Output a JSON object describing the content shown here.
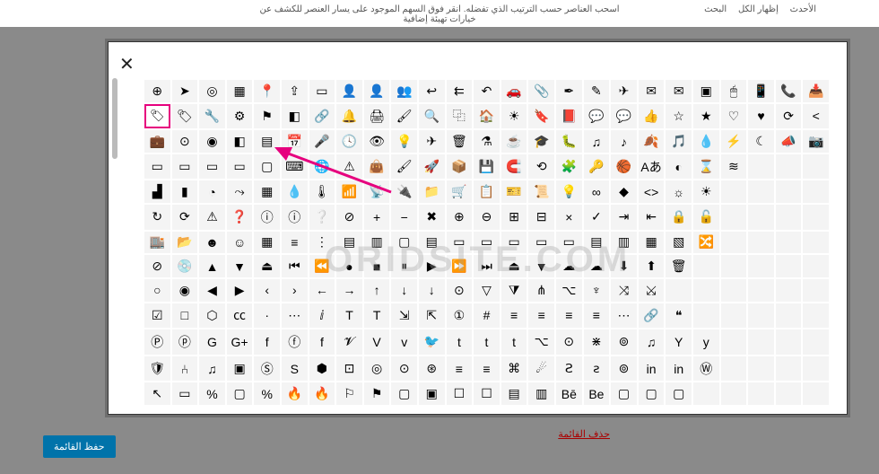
{
  "top_instruction": "اسحب العناصر حسب الترتيب الذي تفضله. انقر فوق السهم الموجود على يسار العنصر للكشف عن خيارات تهيئة إضافية",
  "tabs": {
    "recent": "الأحدث",
    "all": "إظهار الكل",
    "search": "البحث"
  },
  "delete_label": "حذف القائمة",
  "save_label": "حفظ القائمة",
  "watermark": "ORIDSITE.COM",
  "selected_index": 25,
  "icons": [
    "crosshair-icon",
    "location-arrow-icon",
    "compass-icon",
    "map-icon",
    "map-marker-icon",
    "export-icon",
    "contact-card-icon",
    "user-add-icon",
    "user-icon",
    "users-icon",
    "reply-icon",
    "reply-all-icon",
    "undo-icon",
    "car-icon",
    "paperclip-icon",
    "feather-icon",
    "pencil-icon",
    "paper-plane-icon",
    "mail-icon",
    "mail-open-icon",
    "envelope-icon",
    "mouse-icon",
    "mobile-icon",
    "phone-icon",
    "inbox-icon",
    "tag-icon",
    "tags-icon",
    "wrench-icon",
    "gear-icon",
    "flag-icon",
    "color-icon",
    "link-icon",
    "bell-icon",
    "printer-icon",
    "brush-icon",
    "search-icon",
    "copy-icon",
    "home-icon",
    "sun-icon",
    "bookmark-icon",
    "book-icon",
    "chat-icon",
    "chat-alt-icon",
    "thumbs-up-icon",
    "star-outline-icon",
    "star-icon",
    "heart-outline-icon",
    "heart-icon",
    "refresh-icon",
    "share-icon",
    "briefcase-icon",
    "disc-icon",
    "target-icon",
    "approve-icon",
    "calculator-icon",
    "calendar-icon",
    "mic-icon",
    "clock-icon",
    "eye-icon",
    "bulb-icon",
    "plane-icon",
    "trash-icon",
    "beaker-icon",
    "coffee-icon",
    "graduation-icon",
    "bug-icon",
    "music-icon",
    "note-icon",
    "leaf-icon",
    "notes-icon",
    "drop-icon",
    "bolt-icon",
    "moon-icon",
    "megaphone-icon",
    "camera-icon",
    "battery-empty-icon",
    "battery-low-icon",
    "battery-mid-icon",
    "battery-full-icon",
    "window-icon",
    "keyboard-icon",
    "globe-icon",
    "warning-icon",
    "bag-icon",
    "paint-icon",
    "rocket-icon",
    "archive-icon",
    "save-icon",
    "magnet-icon",
    "loop-icon",
    "puzzle-icon",
    "key-icon",
    "basketball-icon",
    "language-icon",
    "dashboard-icon",
    "hourglass-icon",
    "water-icon",
    "blank1-icon",
    "blank2-icon",
    "blank3-icon",
    "area-chart-icon",
    "bar-chart-icon",
    "pie-chart-icon",
    "trend-icon",
    "grid-icon",
    "droplets-icon",
    "thermometer-icon",
    "wifi-icon",
    "rss-icon",
    "plug-icon",
    "folder-icon",
    "cart-icon",
    "clipboard-icon",
    "ticket-icon",
    "certificate-icon",
    "lightbulb-icon",
    "infinity-icon",
    "diamond-icon",
    "code-icon",
    "brightness-icon",
    "sun-small-icon",
    "blank4-icon",
    "blank5-icon",
    "blank6-icon",
    "blank7-icon",
    "rotate-icon",
    "sync-icon",
    "alert-icon",
    "question-icon",
    "info-solid-icon",
    "info-icon",
    "help-icon",
    "block-icon",
    "plus-icon",
    "minus-icon",
    "close-icon",
    "add-circle-icon",
    "remove-circle-icon",
    "plus-square-icon",
    "minus-square-icon",
    "times-icon",
    "check-icon",
    "login-icon",
    "logout-icon",
    "lock-icon",
    "lock-open-icon",
    "blank8-icon",
    "blank9-icon",
    "blank10-icon",
    "blank11-icon",
    "store-icon",
    "folder-open-icon",
    "face-icon",
    "smile-icon",
    "grid2-icon",
    "list-icon",
    "bullets-icon",
    "cards-icon",
    "layout-icon",
    "window2-icon",
    "form-icon",
    "note2-icon",
    "tile1-icon",
    "tile2-icon",
    "tile3-icon",
    "tile4-icon",
    "layout2-icon",
    "layout3-icon",
    "layout4-icon",
    "layout5-icon",
    "shuffle-icon",
    "blank12-icon",
    "blank13-icon",
    "blank14-icon",
    "blank15-icon",
    "crossed-icon",
    "vinyl-icon",
    "caret-up-icon",
    "caret-down-icon",
    "eject-icon",
    "prev-icon",
    "rewind-icon",
    "record-icon",
    "stop-icon",
    "pause-icon",
    "play-icon",
    "forward-icon",
    "next-icon",
    "eject2-icon",
    "down-solid-icon",
    "cloud-icon",
    "cloud-down-icon",
    "download-icon",
    "upload-icon",
    "trash2-icon",
    "blank16-icon",
    "blank17-icon",
    "blank18-icon",
    "blank19-icon",
    "blank20-icon",
    "radio-off-icon",
    "radio-on-icon",
    "caret-left-icon",
    "caret-right-icon",
    "angle-left-icon",
    "angle-right-icon",
    "arrow-left-icon",
    "arrow-right-icon",
    "arrow-up-icon",
    "arrow-down-icon",
    "long-down-icon",
    "circle-down-icon",
    "triangle-down-icon",
    "filter-icon",
    "flow-icon",
    "sitemap-icon",
    "tree-icon",
    "split-icon",
    "merge-icon",
    "blank21-icon",
    "blank22-icon",
    "blank23-icon",
    "blank24-icon",
    "blank25-icon",
    "blank26-icon",
    "checkbox-icon",
    "square-icon",
    "hexagon-icon",
    "cc-icon",
    "dot-icon",
    "dots-icon",
    "italic-icon",
    "text-icon",
    "text2-icon",
    "size-icon",
    "size2-icon",
    "number-icon",
    "hash-icon",
    "align-left-icon",
    "align-right-icon",
    "align-center-icon",
    "justify-icon",
    "more-icon",
    "link2-icon",
    "quote-icon",
    "blank27-icon",
    "blank28-icon",
    "blank29-icon",
    "blank30-icon",
    "blank31-icon",
    "pinterest-icon",
    "pinterest-alt-icon",
    "google-icon",
    "googleplus-icon",
    "facebook-icon",
    "facebook-circle-icon",
    "facebook-square-icon",
    "vine-icon",
    "vimeo-icon",
    "vimeo-alt-icon",
    "twitter-icon",
    "twitter-alt-icon",
    "tumblr-icon",
    "tumblr-alt-icon",
    "github-icon",
    "github-alt-icon",
    "slack-icon",
    "spotify-circle-icon",
    "spotify-icon",
    "yelp-icon",
    "yelp-alt-icon",
    "blank32-icon",
    "blank33-icon",
    "blank34-icon",
    "blank35-icon",
    "shield2-icon",
    "split2-icon",
    "spotify2-icon",
    "inbox2-icon",
    "skype-icon",
    "skype-alt-icon",
    "dropbox-icon",
    "instagram-icon",
    "instagram-alt-icon",
    "pin-circle-icon",
    "renren-icon",
    "stack-icon",
    "stack-alt-icon",
    "lastfm-icon",
    "comment-icon",
    "stumble-icon",
    "stumble-alt-icon",
    "dribbble-icon",
    "linkedin-circle-icon",
    "linkedin-icon",
    "wordpress-icon",
    "blank36-icon",
    "blank37-icon",
    "blank38-icon",
    "blank39-icon",
    "cursor-icon",
    "selection-icon",
    "percent-icon",
    "album-icon",
    "percent2-icon",
    "fire-icon",
    "fire-alt-icon",
    "flag2-icon",
    "flag3-icon",
    "app-icon",
    "app2-icon",
    "box-icon",
    "box2-icon",
    "panel-icon",
    "panel2-icon",
    "behance-icon",
    "behance-alt-icon",
    "square3-icon",
    "square4-icon",
    "square5-icon",
    "blank40-icon",
    "blank41-icon",
    "blank42-icon",
    "blank43-icon",
    "blank44-icon"
  ],
  "glyphs": [
    "⊕",
    "➤",
    "◎",
    "▦",
    "📍",
    "⇪",
    "▭",
    "👤",
    "👤",
    "👥",
    "↩",
    "⇇",
    "↶",
    "🚗",
    "📎",
    "✒",
    "✎",
    "✈",
    "✉",
    "✉",
    "▣",
    "🖱",
    "📱",
    "📞",
    "📥",
    "🏷",
    "🏷",
    "🔧",
    "⚙",
    "⚑",
    "◧",
    "🔗",
    "🔔",
    "🖨",
    "🖌",
    "🔍",
    "⿻",
    "🏠",
    "☀",
    "🔖",
    "📕",
    "💬",
    "💬",
    "👍",
    "☆",
    "★",
    "♡",
    "♥",
    "⟳",
    "<",
    "💼",
    "⊙",
    "◉",
    "◧",
    "▤",
    "📅",
    "🎤",
    "🕓",
    "👁",
    "💡",
    "✈",
    "🗑",
    "⚗",
    "☕",
    "🎓",
    "🐛",
    "♫",
    "♪",
    "🍂",
    "🎵",
    "💧",
    "⚡",
    "☾",
    "📣",
    "📷",
    "▭",
    "▭",
    "▭",
    "▭",
    "▢",
    "⌨",
    "🌐",
    "⚠",
    "👜",
    "🖌",
    "🚀",
    "📦",
    "💾",
    "🧲",
    "⟲",
    "🧩",
    "🔑",
    "🏀",
    "Aあ",
    "◐",
    "⌛",
    "≋",
    "",
    "",
    "",
    "▟",
    "▮",
    "◔",
    "⤳",
    "▦",
    "💧",
    "🌡",
    "📶",
    "📡",
    "🔌",
    "📁",
    "🛒",
    "📋",
    "🎫",
    "📜",
    "💡",
    "∞",
    "◆",
    "<>",
    "☼",
    "☀",
    "",
    "",
    "",
    "",
    "↻",
    "⟳",
    "⚠",
    "❓",
    "ⓘ",
    "ⓘ",
    "❔",
    "⊘",
    "+",
    "−",
    "✖",
    "⊕",
    "⊖",
    "⊞",
    "⊟",
    "×",
    "✓",
    "⇥",
    "⇤",
    "🔒",
    "🔓",
    "",
    "",
    "",
    "",
    "🏬",
    "📂",
    "☻",
    "☺",
    "▦",
    "≡",
    "⋮",
    "▤",
    "▥",
    "▢",
    "▤",
    "▭",
    "▭",
    "▭",
    "▭",
    "▭",
    "▤",
    "▥",
    "▦",
    "▧",
    "🔀",
    "",
    "",
    "",
    "",
    "⊘",
    "💿",
    "▲",
    "▼",
    "⏏",
    "⏮",
    "⏪",
    "●",
    "■",
    "⏸",
    "▶",
    "⏩",
    "⏭",
    "⏏",
    "▼",
    "☁",
    "☁",
    "⬇",
    "⬆",
    "🗑",
    "",
    "",
    "",
    "",
    "",
    "○",
    "◉",
    "◀",
    "▶",
    "‹",
    "›",
    "←",
    "→",
    "↑",
    "↓",
    "↓",
    "⊙",
    "▽",
    "⧩",
    "⋔",
    "⌥",
    "♆",
    "⤨",
    "⤩",
    "",
    "",
    "",
    "",
    "",
    "",
    "☑",
    "□",
    "⬡",
    "㏄",
    "·",
    "⋯",
    "ⅈ",
    "T",
    "T",
    "⇲",
    "⇱",
    "①",
    "#",
    "≡",
    "≡",
    "≡",
    "≡",
    "⋯",
    "🔗",
    "❝",
    "",
    "",
    "",
    "",
    "",
    "Ⓟ",
    "ⓟ",
    "G",
    "G+",
    "f",
    "ⓕ",
    "f",
    "𝓥",
    "V",
    "v",
    "🐦",
    "t",
    "t",
    "t",
    "⌥",
    "⊙",
    "⋇",
    "⊚",
    "♫",
    "Y",
    "y",
    "",
    "",
    "",
    "",
    "🛡",
    "⑃",
    "♫",
    "▣",
    "Ⓢ",
    "S",
    "⬢",
    "⊡",
    "◎",
    "⊙",
    "⊛",
    "≡",
    "≡",
    "⌘",
    "☄",
    "Ꙅ",
    "ꙅ",
    "⊚",
    "in",
    "in",
    "Ⓦ",
    "",
    "",
    "",
    "",
    "↖",
    "▭",
    "%",
    "▢",
    "%",
    "🔥",
    "🔥",
    "⚐",
    "⚑",
    "▢",
    "▣",
    "☐",
    "☐",
    "▤",
    "▥",
    "Bē",
    "Be",
    "▢",
    "▢",
    "▢",
    "",
    "",
    "",
    "",
    ""
  ]
}
